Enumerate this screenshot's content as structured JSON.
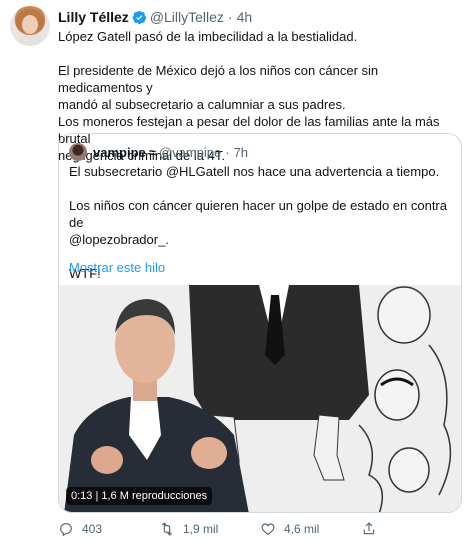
{
  "tweet": {
    "author_name": "Lilly Téllez",
    "handle": "@LillyTellez",
    "time": "4h",
    "paragraphs": [
      [
        "López Gatell pasó de la imbecilidad a la bestialidad."
      ],
      [
        "El presidente de México dejó a los niños con cáncer sin medicamentos y",
        "mandó al subsecretario a calumniar a sus padres.",
        "Los moneros festejan a pesar del dolor de las familias ante la más brutal",
        "negligencia criminal de la 4T."
      ]
    ]
  },
  "quoted": {
    "author_name": "vampipe",
    "symbol": "≈",
    "handle": "@vampipe",
    "time": "7h",
    "lines": [
      "El subsecretario @HLGatell nos hace una advertencia a tiempo.",
      "",
      "Los niños con cáncer quieren hacer un golpe de estado en contra de",
      "@lopezobrador_.",
      "",
      "WTF!"
    ],
    "show_thread": "Mostrar este hilo",
    "video_badge": "0:13 | 1,6 M reproducciones"
  },
  "actions": {
    "replies": "403",
    "retweets": "1,9 mil",
    "likes": "4,6 mil"
  },
  "colors": {
    "link": "#1d9bf0",
    "verified": "#1d9bf0",
    "muted": "#536471",
    "border": "#cfd9de"
  },
  "icons": [
    "verified-badge-icon",
    "reply-icon",
    "retweet-icon",
    "like-icon",
    "share-icon"
  ]
}
